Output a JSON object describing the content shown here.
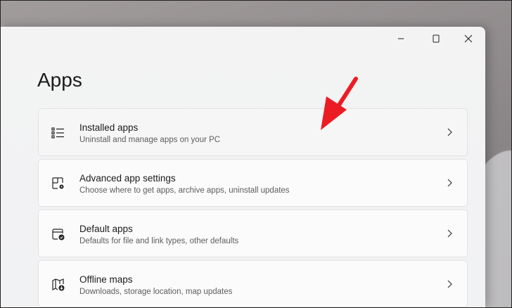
{
  "page": {
    "title": "Apps"
  },
  "window_controls": {
    "minimize": "–",
    "maximize": "□",
    "close": "✕"
  },
  "items": [
    {
      "title": "Installed apps",
      "subtitle": "Uninstall and manage apps on your PC",
      "icon": "list-icon"
    },
    {
      "title": "Advanced app settings",
      "subtitle": "Choose where to get apps, archive apps, uninstall updates",
      "icon": "app-settings-icon"
    },
    {
      "title": "Default apps",
      "subtitle": "Defaults for file and link types, other defaults",
      "icon": "default-apps-icon"
    },
    {
      "title": "Offline maps",
      "subtitle": "Downloads, storage location, map updates",
      "icon": "offline-maps-icon"
    }
  ],
  "annotation": {
    "arrow_color": "#ec1c24"
  }
}
